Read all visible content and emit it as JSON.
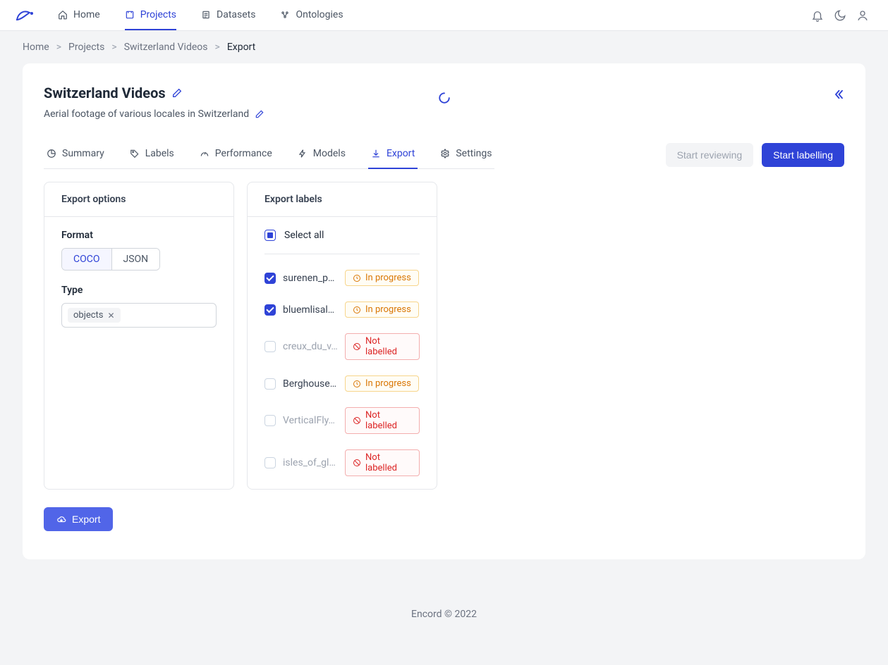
{
  "nav": {
    "home": "Home",
    "projects": "Projects",
    "datasets": "Datasets",
    "ontologies": "Ontologies"
  },
  "breadcrumb": {
    "home": "Home",
    "projects": "Projects",
    "project": "Switzerland Videos",
    "current": "Export"
  },
  "project": {
    "title": "Switzerland Videos",
    "subtitle": "Aerial footage of various locales in Switzerland"
  },
  "tabs": {
    "summary": "Summary",
    "labels": "Labels",
    "performance": "Performance",
    "models": "Models",
    "export": "Export",
    "settings": "Settings"
  },
  "actions": {
    "start_reviewing": "Start reviewing",
    "start_labelling": "Start labelling",
    "export": "Export"
  },
  "export_options": {
    "header": "Export options",
    "format_label": "Format",
    "format_coco": "COCO",
    "format_json": "JSON",
    "type_label": "Type",
    "type_tag": "objects"
  },
  "export_labels": {
    "header": "Export labels",
    "select_all": "Select all",
    "status": {
      "in_progress": "In progress",
      "not_labelled": "Not labelled"
    },
    "items": [
      {
        "name": "surenen_pa…",
        "checked": true,
        "status": "in_progress",
        "disabled": false
      },
      {
        "name": "bluemlisalph…",
        "checked": true,
        "status": "in_progress",
        "disabled": false
      },
      {
        "name": "creux_du_v…",
        "checked": false,
        "status": "not_labelled",
        "disabled": true
      },
      {
        "name": "Berghouse L…",
        "checked": false,
        "status": "in_progress",
        "disabled": false
      },
      {
        "name": "VerticalFly…",
        "checked": false,
        "status": "not_labelled",
        "disabled": true
      },
      {
        "name": "isles_of_gle…",
        "checked": false,
        "status": "not_labelled",
        "disabled": true
      }
    ]
  },
  "footer": "Encord © 2022"
}
